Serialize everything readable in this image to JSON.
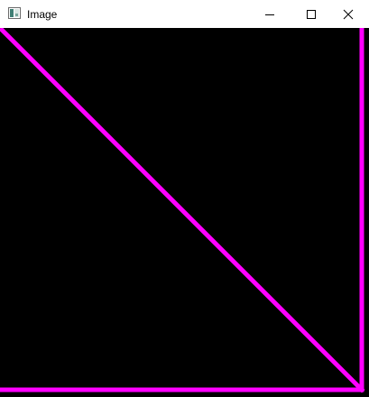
{
  "window": {
    "title": "Image",
    "app_icon": "image-window-icon",
    "buttons": {
      "minimize_icon": "minimize-icon",
      "maximize_icon": "maximize-icon",
      "close_icon": "close-icon"
    }
  },
  "image": {
    "background_color": "#000000",
    "line_color": "#ff00ff",
    "shapes": [
      "diagonal-line",
      "right-edge-line",
      "bottom-edge-line"
    ]
  }
}
